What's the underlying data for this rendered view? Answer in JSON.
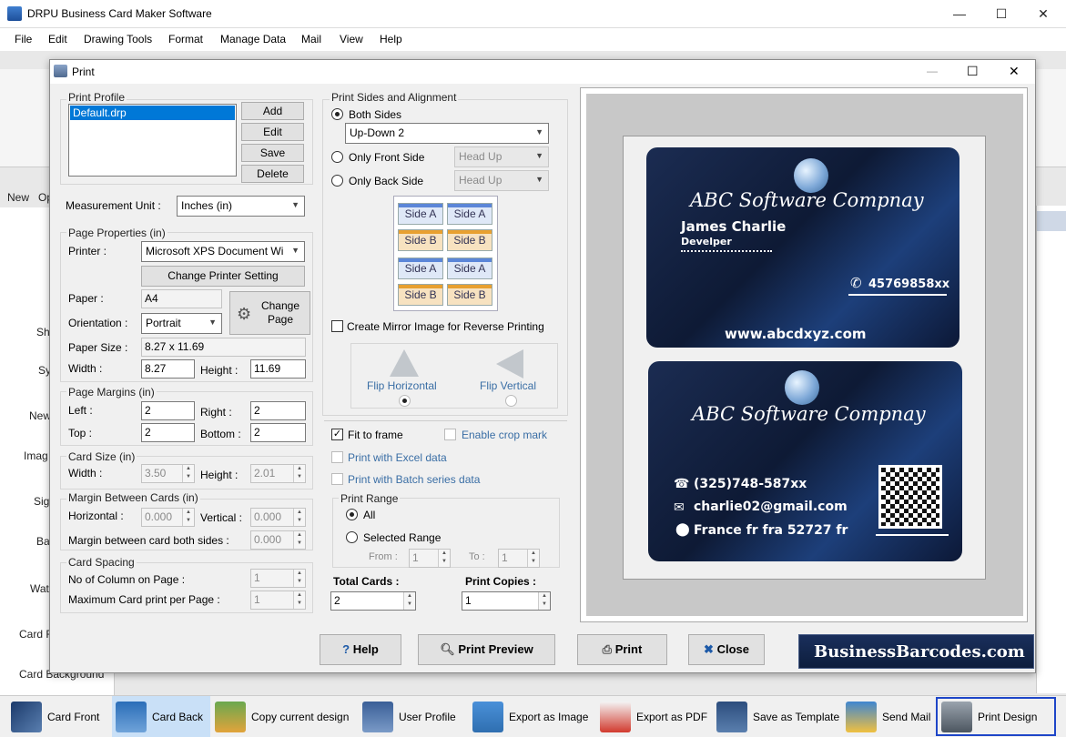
{
  "app": {
    "title": "DRPU Business Card Maker Software"
  },
  "window_controls": {
    "minimize": "—",
    "maximize": "☐",
    "close": "✕"
  },
  "menu": [
    "File",
    "Edit",
    "Drawing Tools",
    "Format",
    "Manage Data",
    "Mail",
    "View",
    "Help"
  ],
  "background": {
    "labels": [
      "New",
      "Op",
      "Sh",
      "Sy",
      "New",
      "Imag",
      "Sig",
      "Ba",
      "Wat",
      "Card F",
      "Card Background"
    ]
  },
  "dialog": {
    "title": "Print",
    "print_profile": {
      "label": "Print Profile",
      "items": [
        "Default.drp"
      ],
      "buttons": {
        "add": "Add",
        "edit": "Edit",
        "save": "Save",
        "delete": "Delete"
      }
    },
    "measurement_unit": {
      "label": "Measurement Unit :",
      "value": "Inches (in)"
    },
    "page_properties": {
      "label": "Page Properties (in)",
      "printer_label": "Printer :",
      "printer_value": "Microsoft XPS Document Wi",
      "change_printer": "Change Printer Setting",
      "paper_label": "Paper :",
      "paper_value": "A4",
      "change_page": "Change Page",
      "orientation_label": "Orientation :",
      "orientation_value": "Portrait",
      "paper_size_label": "Paper Size :",
      "paper_size_value": "8.27 x 11.69",
      "width_label": "Width :",
      "width_value": "8.27",
      "height_label": "Height :",
      "height_value": "11.69"
    },
    "page_margins": {
      "label": "Page Margins (in)",
      "left_label": "Left :",
      "left_value": "2",
      "right_label": "Right :",
      "right_value": "2",
      "top_label": "Top :",
      "top_value": "2",
      "bottom_label": "Bottom :",
      "bottom_value": "2"
    },
    "card_size": {
      "label": "Card Size (in)",
      "width_label": "Width :",
      "width_value": "3.50",
      "height_label": "Height :",
      "height_value": "2.01"
    },
    "margin_between": {
      "label": "Margin Between Cards (in)",
      "horizontal_label": "Horizontal :",
      "horizontal_value": "0.000",
      "vertical_label": "Vertical :",
      "vertical_value": "0.000",
      "both_label": "Margin between card both sides :",
      "both_value": "0.000"
    },
    "card_spacing": {
      "label": "Card Spacing",
      "columns_label": "No of Column on Page :",
      "columns_value": "1",
      "max_label": "Maximum Card print per Page :",
      "max_value": "1"
    },
    "sides": {
      "label": "Print Sides and Alignment",
      "both_sides": "Both Sides",
      "both_value": "Up-Down 2",
      "only_front": "Only Front Side",
      "front_value": "Head Up",
      "only_back": "Only Back Side",
      "back_value": "Head Up",
      "side_a": "Side A",
      "side_b": "Side B",
      "mirror": "Create Mirror Image for Reverse Printing",
      "flip_horizontal": "Flip Horizontal",
      "flip_vertical": "Flip Vertical"
    },
    "options": {
      "fit_to_frame": "Fit to frame",
      "enable_crop": "Enable crop mark",
      "excel": "Print with Excel data",
      "batch": "Print with Batch series data"
    },
    "print_range": {
      "label": "Print Range",
      "all": "All",
      "selected": "Selected Range",
      "from_label": "From :",
      "from_value": "1",
      "to_label": "To :",
      "to_value": "1"
    },
    "totals": {
      "total_label": "Total Cards :",
      "total_value": "2",
      "copies_label": "Print Copies :",
      "copies_value": "1"
    },
    "buttons": {
      "help": "Help",
      "print_preview": "Print Preview",
      "print": "Print",
      "close": "Close"
    },
    "brand": "BusinessBarcodes.com",
    "card_front": {
      "company": "ABC Software Compnay",
      "name": "James Charlie",
      "role": "Develper",
      "phone": "45769858xx",
      "website": "www.abcdxyz.com"
    },
    "card_back": {
      "company": "ABC Software Compnay",
      "phone": "(325)748-587xx",
      "email": "charlie02@gmail.com",
      "address": "France fr fra 52727 fr"
    }
  },
  "toolbar": {
    "items": [
      "Card Front",
      "Card Back",
      "Copy current design",
      "User Profile",
      "Export as Image",
      "Export as PDF",
      "Save as Template",
      "Send Mail",
      "Print Design"
    ]
  },
  "colors": {
    "accent": "#0078d7",
    "card_dark": "#0e1a35",
    "brand_bg": "#0d1e3d"
  }
}
